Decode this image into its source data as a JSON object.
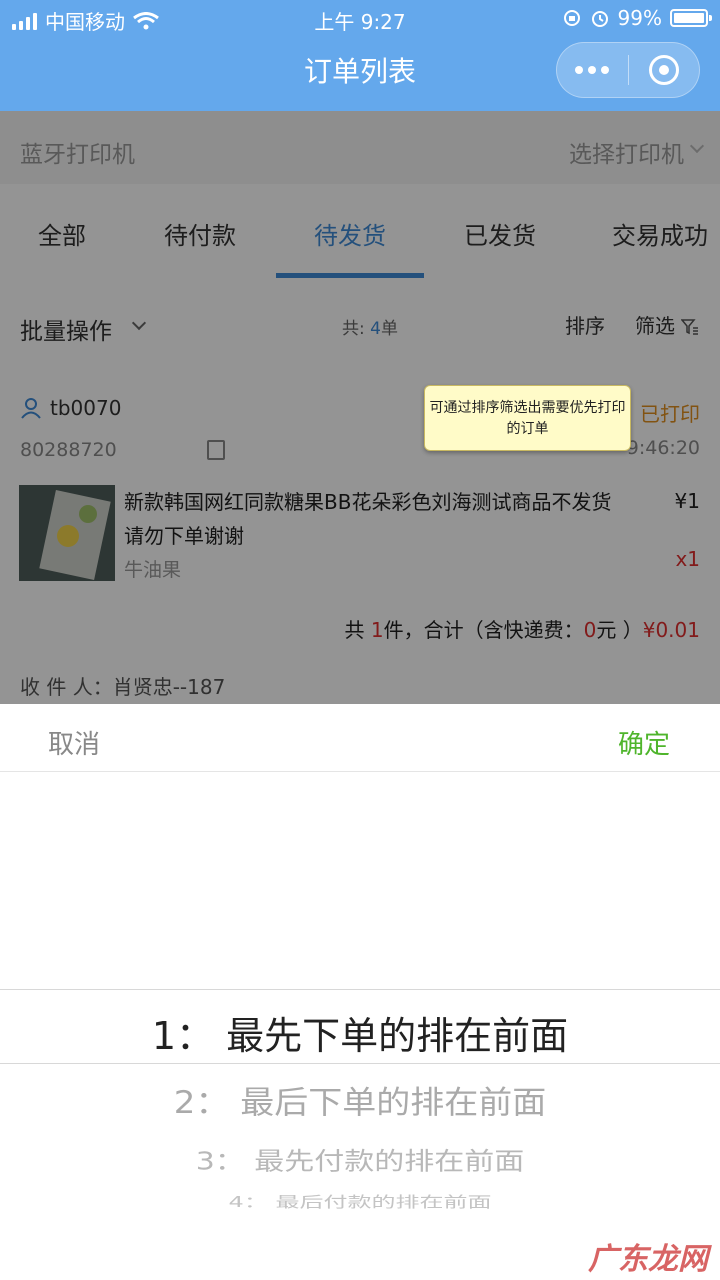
{
  "status_bar": {
    "carrier": "中国移动",
    "time": "上午 9:27",
    "battery": "99%",
    "battery_level": 0.99
  },
  "nav": {
    "title": "订单列表"
  },
  "printer": {
    "label": "蓝牙打印机",
    "select": "选择打印机"
  },
  "tabs": [
    {
      "label": "全部"
    },
    {
      "label": "待付款"
    },
    {
      "label": "待发货"
    },
    {
      "label": "已发货"
    },
    {
      "label": "交易成功"
    }
  ],
  "active_tab": "待发货",
  "toolbar": {
    "batch": "批量操作",
    "count_prefix": "共: ",
    "count_value": "4",
    "count_suffix": "单",
    "sort": "排序",
    "filter": "筛选"
  },
  "tooltip": "可通过排序筛选出需要优先打印的订单",
  "order": {
    "buyer": "tb0070",
    "status": "已打印",
    "order_no": "80288720",
    "time": "9:46:20",
    "goods_name": "新款韩国网红同款糖果BB花朵彩色刘海测试商品不发货请勿下单谢谢",
    "goods_spec": "牛油果",
    "price": "¥1",
    "qty": "x1",
    "summary_1": "共 ",
    "summary_count": "1",
    "summary_2": "件，合计（含快递费：",
    "summary_fee": "0",
    "summary_3": "元 ）",
    "summary_total": "¥0.01",
    "receiver": "收 件 人：肖贤忠--187"
  },
  "sheet": {
    "cancel": "取消",
    "confirm": "确定",
    "options": [
      "1：  最先下单的排在前面",
      "2：  最后下单的排在前面",
      "3：  最先付款的排在前面",
      "4：  最后付款的排在前面"
    ]
  },
  "watermark": "广东龙网"
}
